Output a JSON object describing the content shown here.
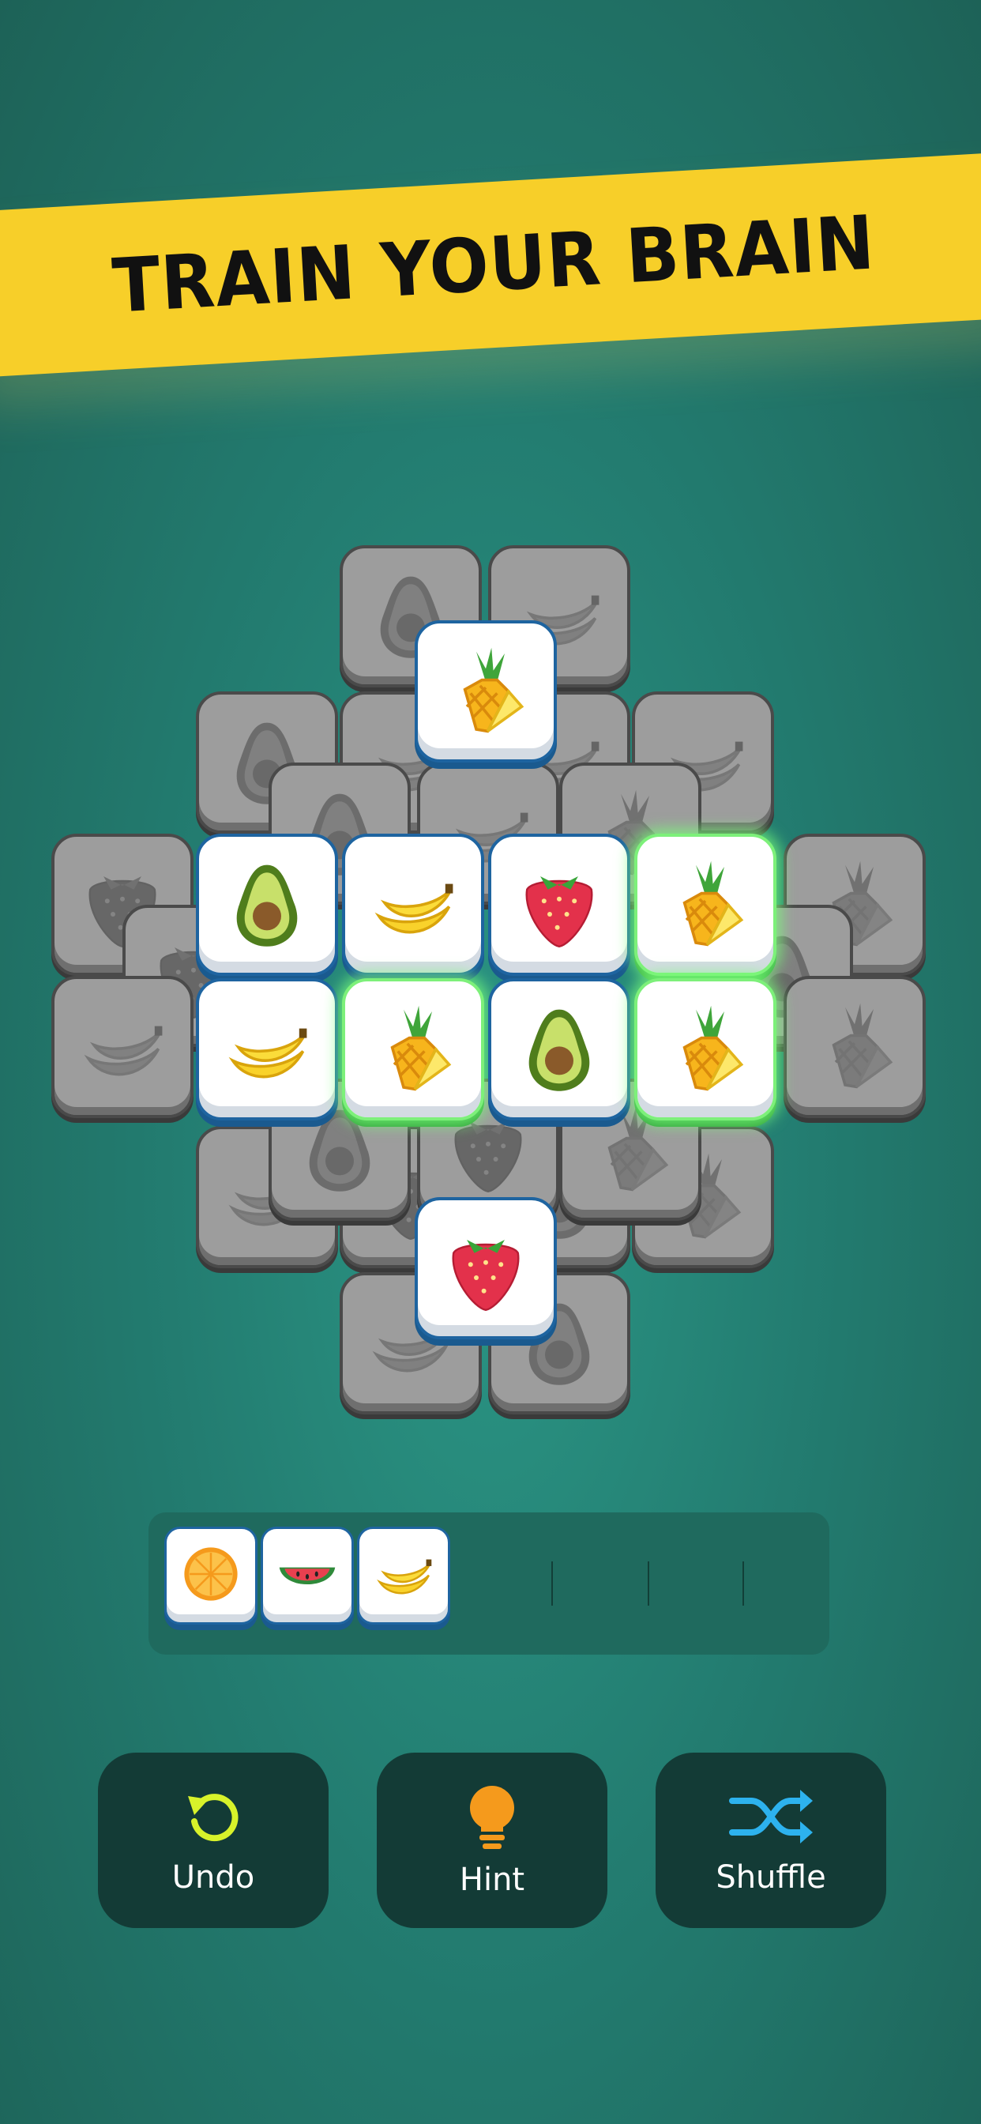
{
  "banner": {
    "title": "TRAIN YOUR BRAIN"
  },
  "colors": {
    "background": "#237d71",
    "banner": "#f7cf29",
    "button_bg": "#133b36",
    "tile_border": "#1e64a0",
    "selected_glow": "#7df07a",
    "undo_icon": "#d8f22a",
    "hint_icon": "#f59a1c",
    "shuffle_icon": "#2db2ee"
  },
  "board": {
    "tile_types": [
      "avocado",
      "banana",
      "strawberry",
      "pineapple"
    ],
    "top_layer": {
      "selected": "pineapple",
      "selected_count": 3
    }
  },
  "tray": {
    "capacity": 7,
    "filled": [
      "orange",
      "watermelon",
      "banana"
    ]
  },
  "buttons": [
    {
      "id": "undo",
      "label": "Undo",
      "icon": "undo-icon"
    },
    {
      "id": "hint",
      "label": "Hint",
      "icon": "lightbulb-icon"
    },
    {
      "id": "shuffle",
      "label": "Shuffle",
      "icon": "shuffle-icon"
    }
  ]
}
